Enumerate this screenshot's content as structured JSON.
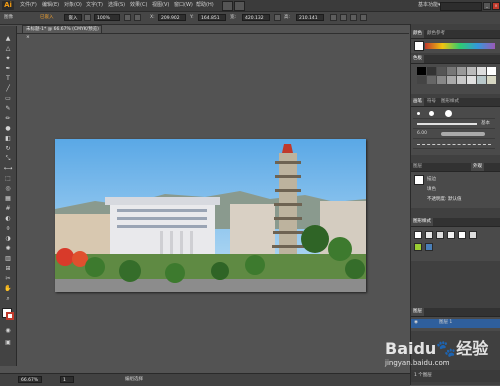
{
  "app": {
    "logo": "Ai",
    "workspace": "基本功能",
    "workspace_arrow": "▾"
  },
  "menu": [
    "文件(F)",
    "编辑(E)",
    "对象(O)",
    "文字(T)",
    "选择(S)",
    "效果(C)",
    "视图(V)",
    "窗口(W)",
    "帮助(H)"
  ],
  "control_bar": {
    "mode_label": "图像",
    "linked_label": "已嵌入",
    "embed_button": "嵌入",
    "opacity_label": "不透明度",
    "opacity_value": "100%",
    "x_label": "X:",
    "x_value": "209.902",
    "y_label": "Y:",
    "y_value": "164.851",
    "w_label": "宽:",
    "w_value": "420.132",
    "h_label": "高:",
    "h_value": "210.141"
  },
  "document_tab": {
    "title": "未标题-1* @ 66.67% (CMYK/预览)",
    "close": "×"
  },
  "status_bar": {
    "zoom": "66.67%",
    "page": "1",
    "tool": "编组选择"
  },
  "panels": {
    "color_tabs": [
      "颜色",
      "颜色参考"
    ],
    "swatch_tabs": [
      "色板"
    ],
    "brush_tabs": [
      "画笔",
      "符号",
      "图形样式"
    ],
    "brush_label": "基本",
    "brush_size": "6.00",
    "appearance_tabs": [
      "图层",
      "外观"
    ],
    "appearance_items": [
      "描边",
      "填色",
      "不透明度: 默认值"
    ],
    "graphic_styles_tab": "图形样式",
    "layers_tab": "图层",
    "layer_name": "图层 1",
    "layers_count": "1 个图层"
  },
  "watermark": {
    "brand": "Baidu",
    "product": "经验",
    "url": "jingyan.baidu.com"
  },
  "colors": {
    "ui_dark": "#3b3b3b",
    "canvas_bg": "#535353",
    "accent_orange": "#f39c12",
    "selected_blue": "#2f5f9c"
  }
}
